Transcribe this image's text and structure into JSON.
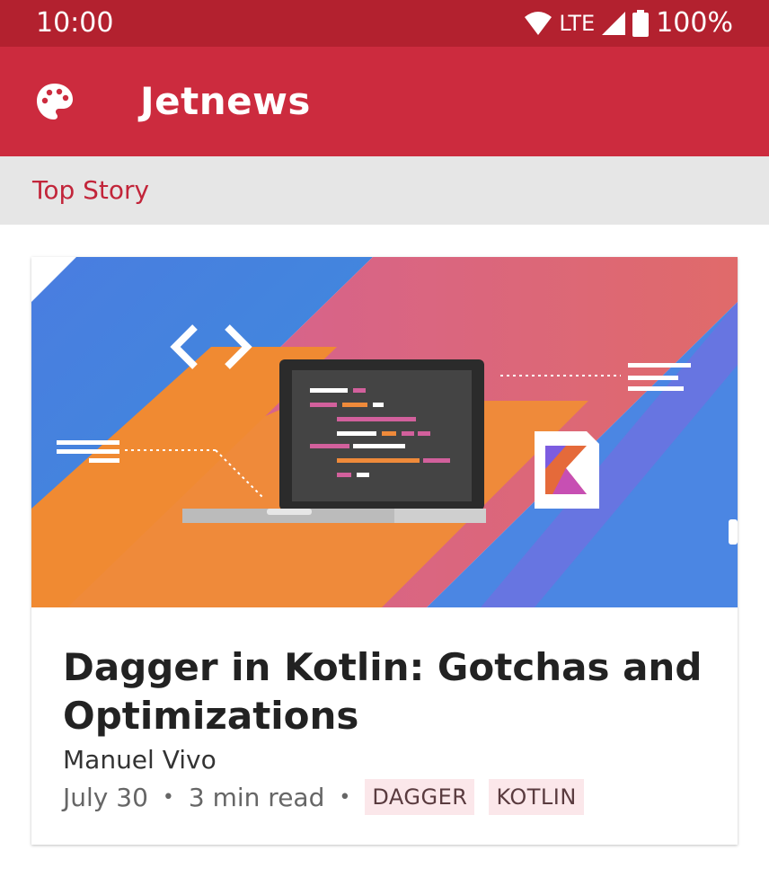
{
  "status_bar": {
    "time": "10:00",
    "network": "LTE",
    "battery": "100%"
  },
  "app_bar": {
    "title": "Jetnews",
    "icon": "palette-icon"
  },
  "section": {
    "title": "Top Story"
  },
  "post": {
    "title": "Dagger in Kotlin: Gotchas and Optimizations",
    "author": "Manuel Vivo",
    "date": "July 30",
    "read_time": "3 min read",
    "separator": "•",
    "tags": [
      "DAGGER",
      "KOTLIN"
    ]
  },
  "colors": {
    "status_bar": "#b3212f",
    "app_bar": "#cc2b3e",
    "accent": "#c2253a",
    "tag_bg": "#fbe7ea"
  }
}
